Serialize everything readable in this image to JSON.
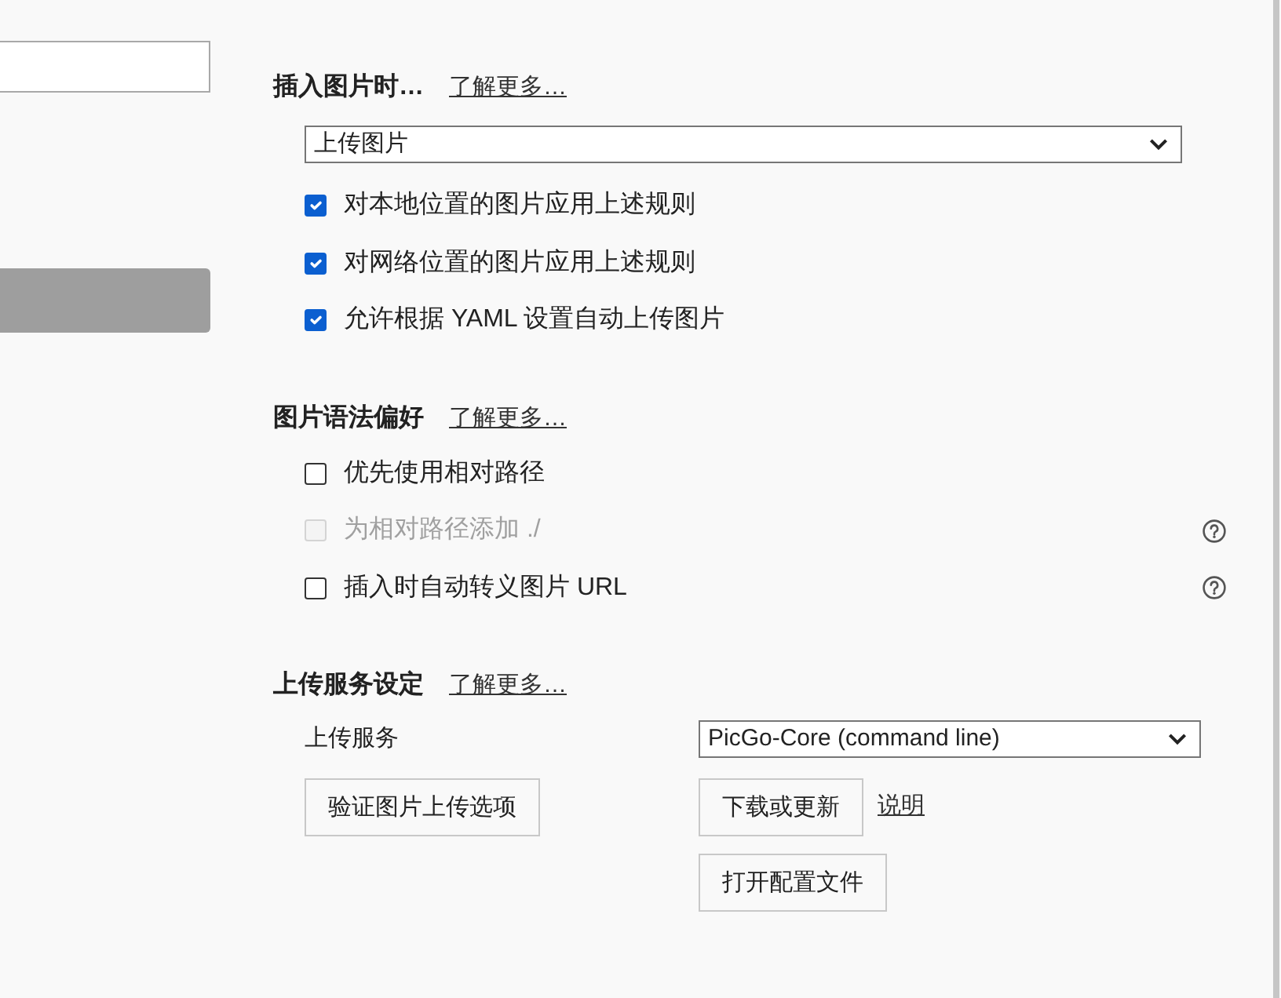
{
  "sidebar": {
    "items": [
      {
        "kind": "input"
      },
      {
        "kind": "button"
      }
    ]
  },
  "sections": [
    {
      "title": "插入图片时…",
      "link": "了解更多…",
      "dropdown": {
        "value": "上传图片"
      },
      "options": [
        {
          "label": "对本地位置的图片应用上述规则",
          "checked": true
        },
        {
          "label": "对网络位置的图片应用上述规则",
          "checked": true
        },
        {
          "label": "允许根据 YAML 设置自动上传图片",
          "checked": true
        }
      ]
    },
    {
      "title": "图片语法偏好",
      "link": "了解更多…",
      "options": [
        {
          "label": "优先使用相对路径",
          "checked": false,
          "disabled": false,
          "help": false
        },
        {
          "label": "为相对路径添加 ./",
          "checked": false,
          "disabled": true,
          "help": true
        },
        {
          "label": "插入时自动转义图片 URL",
          "checked": false,
          "disabled": false,
          "help": true
        }
      ]
    },
    {
      "title": "上传服务设定",
      "link": "了解更多…",
      "service": {
        "label": "上传服务",
        "value": "PicGo-Core (command line)"
      },
      "left_actions": [
        [
          {
            "kind": "button",
            "label": "验证图片上传选项"
          }
        ]
      ],
      "right_actions": [
        [
          {
            "kind": "button",
            "label": "下载或更新"
          },
          {
            "kind": "link",
            "label": "说明"
          }
        ],
        [
          {
            "kind": "button",
            "label": "打开配置文件"
          }
        ]
      ]
    }
  ]
}
